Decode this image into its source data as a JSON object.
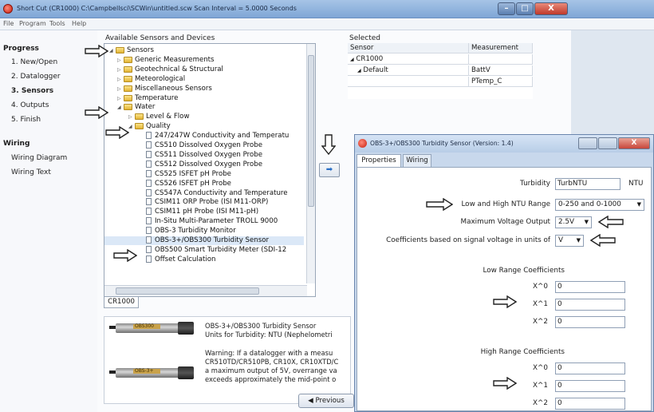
{
  "main_window": {
    "title": "Short Cut (CR1000) C:\\Campbellsci\\SCWin\\untitled.scw      Scan Interval = 5.0000 Seconds",
    "controls": {
      "minimize": "–",
      "maximize": "□",
      "close": "X"
    }
  },
  "menu": [
    "File",
    "Program",
    "Tools",
    "Help"
  ],
  "wizard_nav": {
    "progress_heading": "Progress",
    "steps": [
      {
        "label": "1. New/Open",
        "active": false
      },
      {
        "label": "2. Datalogger",
        "active": false
      },
      {
        "label": "3. Sensors",
        "active": true
      },
      {
        "label": "4. Outputs",
        "active": false
      },
      {
        "label": "5. Finish",
        "active": false
      }
    ],
    "wiring_heading": "Wiring",
    "wiring_items": [
      "Wiring Diagram",
      "Wiring Text"
    ]
  },
  "available": {
    "heading": "Available Sensors and Devices",
    "tree": [
      {
        "label": "Sensors",
        "type": "folder",
        "level": 0,
        "expanded": true
      },
      {
        "label": "Generic Measurements",
        "type": "folder",
        "level": 1
      },
      {
        "label": "Geotechnical & Structural",
        "type": "folder",
        "level": 1
      },
      {
        "label": "Meteorological",
        "type": "folder",
        "level": 1
      },
      {
        "label": "Miscellaneous Sensors",
        "type": "folder",
        "level": 1
      },
      {
        "label": "Temperature",
        "type": "folder",
        "level": 1
      },
      {
        "label": "Water",
        "type": "folder",
        "level": 1,
        "expanded": true
      },
      {
        "label": "Level & Flow",
        "type": "folder",
        "level": 2
      },
      {
        "label": "Quality",
        "type": "folder",
        "level": 2,
        "expanded": true
      },
      {
        "label": "247/247W Conductivity and Temperatu",
        "type": "doc",
        "level": 3
      },
      {
        "label": "CS510 Dissolved Oxygen Probe",
        "type": "doc",
        "level": 3
      },
      {
        "label": "CS511 Dissolved Oxygen Probe",
        "type": "doc",
        "level": 3
      },
      {
        "label": "CS512 Dissolved Oxygen Probe",
        "type": "doc",
        "level": 3
      },
      {
        "label": "CS525 ISFET pH Probe",
        "type": "doc",
        "level": 3
      },
      {
        "label": "CS526 ISFET pH Probe",
        "type": "doc",
        "level": 3
      },
      {
        "label": "CS547A Conductivity and Temperature",
        "type": "doc",
        "level": 3
      },
      {
        "label": "CSIM11 ORP Probe (ISI M11-ORP)",
        "type": "doc",
        "level": 3
      },
      {
        "label": "CSIM11 pH Probe (ISI M11-pH)",
        "type": "doc",
        "level": 3
      },
      {
        "label": "In-Situ Multi-Parameter TROLL 9000",
        "type": "doc",
        "level": 3
      },
      {
        "label": "OBS-3 Turbidity Monitor",
        "type": "doc",
        "level": 3
      },
      {
        "label": "OBS-3+/OBS300 Turbidity Sensor",
        "type": "doc",
        "level": 3,
        "selected": true
      },
      {
        "label": "OBS500 Smart Turbidity Meter (SDI-12",
        "type": "doc",
        "level": 3
      },
      {
        "label": "Offset Calculation",
        "type": "doc",
        "level": 3
      }
    ],
    "tab": "CR1000"
  },
  "selected": {
    "heading": "Selected",
    "columns": [
      "Sensor",
      "Measurement"
    ],
    "rows": [
      {
        "sensor": "CR1000",
        "measurement": "",
        "indent": 0,
        "tri": "◢"
      },
      {
        "sensor": "Default",
        "measurement": "BattV",
        "indent": 1,
        "tri": "◢"
      },
      {
        "sensor": "",
        "measurement": "PTemp_C",
        "indent": 2,
        "tri": ""
      }
    ]
  },
  "add_button": "➡",
  "info": {
    "probe_labels": [
      "OBS300",
      "OBS-3+"
    ],
    "lines": [
      "OBS-3+/OBS300 Turbidity Sensor",
      "Units for Turbidity: NTU (Nephelometri",
      "",
      "Warning: If a datalogger with a measu",
      "CR510TD/CR510PB, CR10X, CR10XTD/C",
      "a maximum output of 5V, overrange va",
      "exceeds approximately the mid-point o"
    ]
  },
  "previous_button": "◀ Previous",
  "dialog": {
    "title": "OBS-3+/OBS300 Turbidity Sensor (Version: 1.4)",
    "tabs": [
      "Properties",
      "Wiring"
    ],
    "turbidity_label": "Turbidity",
    "turbidity_value": "TurbNTU",
    "turbidity_unit": "NTU",
    "range_label": "Low and High NTU Range",
    "range_value": "0-250 and 0-1000",
    "voltage_label": "Maximum Voltage Output",
    "voltage_value": "2.5V",
    "coeff_units_label": "Coefficients based on signal voltage in units of",
    "coeff_units_value": "V",
    "low_heading": "Low Range Coefficients",
    "high_heading": "High Range Coefficients",
    "coeff_labels": [
      "X^0",
      "X^1",
      "X^2"
    ],
    "low_values": [
      "0",
      "0",
      "0"
    ],
    "high_values": [
      "0",
      "0",
      "0"
    ]
  },
  "colors": {
    "arrow_outline": "#222222",
    "accent_blue": "#2a6fc6",
    "close_red": "#c0392b"
  }
}
